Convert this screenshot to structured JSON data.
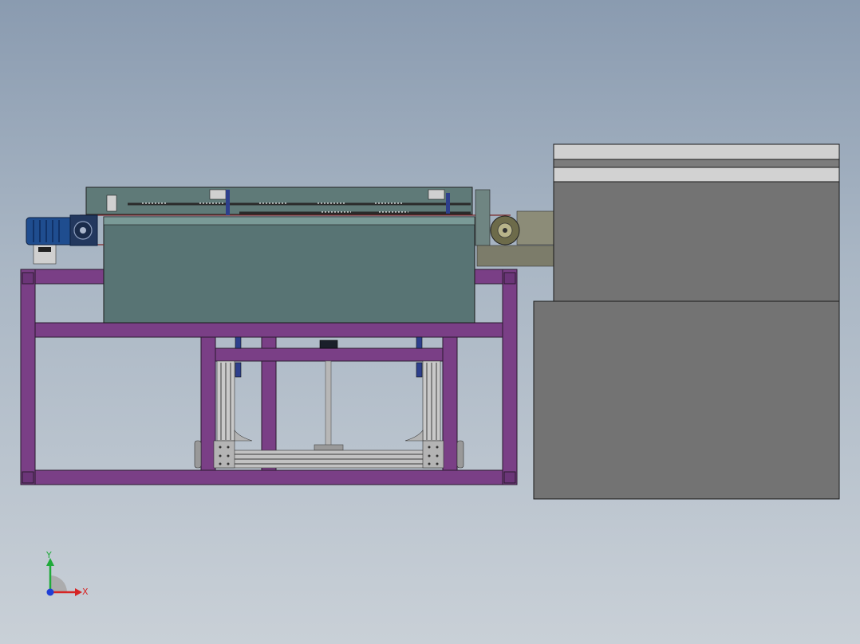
{
  "viewport": {
    "background_top": "#8a9bb0",
    "background_bottom": "#c9d0d7"
  },
  "model": {
    "frame_color": "#7a3f86",
    "tank_color": "#587474",
    "cabinet_color": "#737373",
    "motor_color": "#1f4d8f"
  },
  "triad": {
    "x_label": "X",
    "y_label": "Y",
    "x_color": "#d62424",
    "y_color": "#1faa3a",
    "z_color": "#1f3fd6"
  }
}
